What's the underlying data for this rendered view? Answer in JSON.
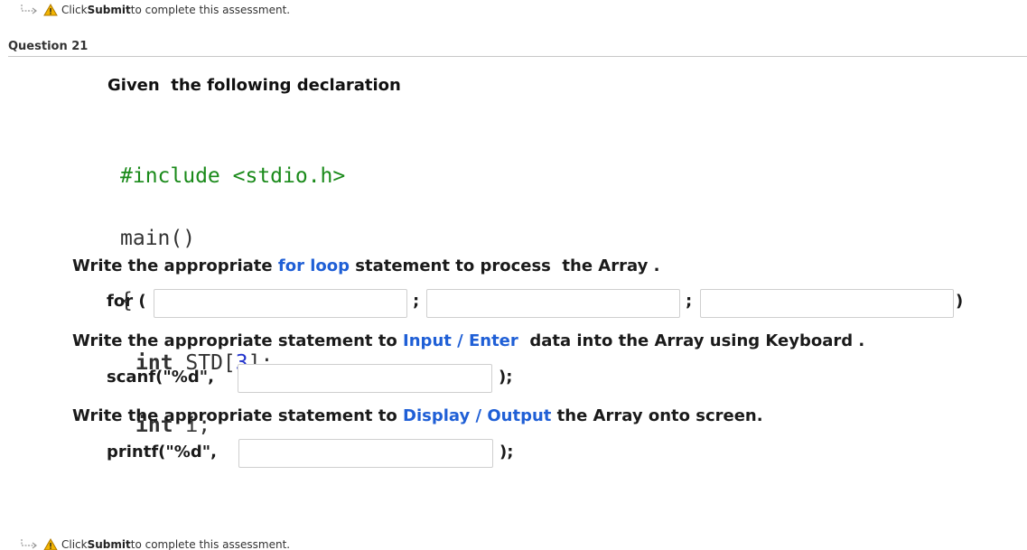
{
  "notice": {
    "prefix": "Click ",
    "strong": "Submit",
    "suffix": " to complete this assessment."
  },
  "question": {
    "header": "Question 21",
    "intro": "Given  the following declaration",
    "code": {
      "line1": "#include <stdio.h>",
      "line2": "main()",
      "line3": "{",
      "line4_kw": "int",
      "line4_ident": " STD[",
      "line4_num": "3",
      "line4_end": "];",
      "line5_kw": "int",
      "line5_rest": " i;"
    },
    "for_loop": {
      "instruction_pre": "Write the appropriate ",
      "instruction_highlight": "for loop",
      "instruction_post": " statement to process  the Array .",
      "label": "for (",
      "sep1": ";",
      "sep2": ";",
      "close": ")",
      "field1_value": "",
      "field2_value": "",
      "field3_value": ""
    },
    "input": {
      "instruction_pre": "Write the appropriate statement to ",
      "instruction_highlight": "Input / Enter",
      "instruction_post": "  data into the Array using Keyboard .",
      "label": "scanf(\"%d\",",
      "close": ");",
      "field_value": ""
    },
    "output": {
      "instruction_pre": "Write the appropriate statement to ",
      "instruction_highlight": "Display / Output",
      "instruction_post": " the Array onto screen.",
      "label": "printf(\"%d\",",
      "close": ");",
      "field_value": ""
    }
  },
  "colors": {
    "highlight": "#1f5fd6",
    "include_green": "#1a8a1a",
    "warning": "#e8a000"
  },
  "icons": {
    "arrow": "arrow-right-icon",
    "warning": "warning-icon"
  }
}
